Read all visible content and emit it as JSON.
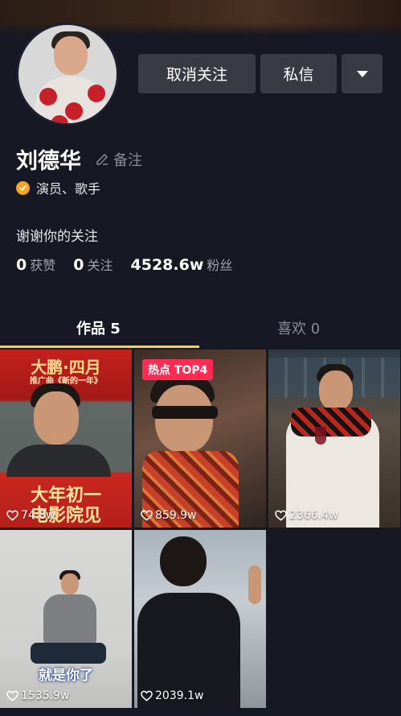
{
  "profile": {
    "name": "刘德华",
    "remark_label": "备注",
    "verification": "演员、歌手",
    "bio": "谢谢你的关注"
  },
  "actions": {
    "unfollow_label": "取消关注",
    "message_label": "私信",
    "more_icon": "caret-down-icon"
  },
  "stats": [
    {
      "value": "0",
      "label": "获赞"
    },
    {
      "value": "0",
      "label": "关注"
    },
    {
      "value": "4528.6w",
      "label": "粉丝"
    }
  ],
  "tabs": [
    {
      "label": "作品 5",
      "active": true
    },
    {
      "label": "喜欢 0",
      "active": false
    }
  ],
  "videos": [
    {
      "likes": "74.8w",
      "title_text": "大鹏·四月",
      "sub_text": "推广曲《新的一年》",
      "caption_line1": "大年初一",
      "caption_line2": "电影院见"
    },
    {
      "likes": "859.9w",
      "badge": "热点 TOP4"
    },
    {
      "likes": "2366.4w"
    },
    {
      "likes": "1535.9w",
      "caption": "就是你了"
    },
    {
      "likes": "2039.1w"
    }
  ],
  "colors": {
    "background": "#161823",
    "button": "#393b44",
    "tab_indicator": "#fdd32a",
    "hot_badge": "#fe2c55",
    "verify_badge": "#f5a623"
  }
}
